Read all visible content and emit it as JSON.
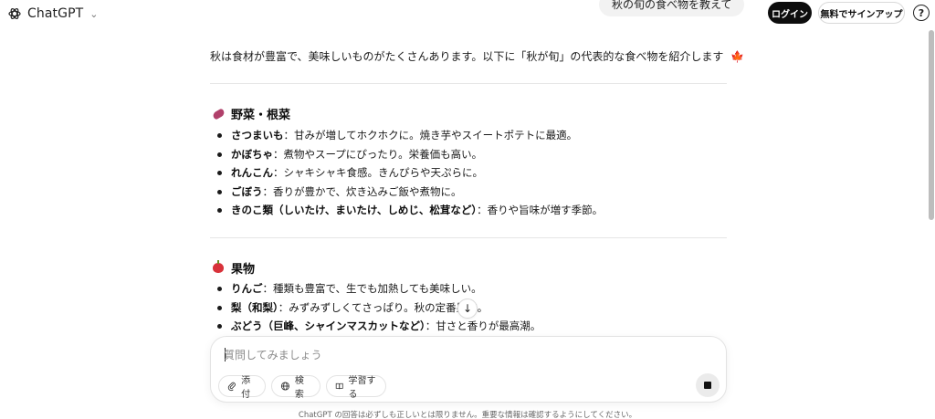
{
  "header": {
    "app_title": "ChatGPT",
    "login_label": "ログイン",
    "signup_label": "無料でサインアップ",
    "help_label": "?"
  },
  "user_message": "秋の旬の食べ物を教えて",
  "assistant": {
    "intro": "秋は食材が豊富で、美味しいものがたくさんあります。以下に「秋が旬」の代表的な食べ物を紹介します",
    "intro_emoji": "🍁",
    "sections": [
      {
        "title": "野菜・根菜",
        "items": [
          {
            "name": "さつまいも",
            "desc": "：甘みが増してホクホクに。焼き芋やスイートポテトに最適。"
          },
          {
            "name": "かぼちゃ",
            "desc": "：煮物やスープにぴったり。栄養価も高い。"
          },
          {
            "name": "れんこん",
            "desc": "：シャキシャキ食感。きんぴらや天ぷらに。"
          },
          {
            "name": "ごぼう",
            "desc": "：香りが豊かで、炊き込みご飯や煮物に。"
          },
          {
            "name": "きのこ類（しいたけ、まいたけ、しめじ、松茸など）",
            "desc": "：香りや旨味が増す季節。"
          }
        ]
      },
      {
        "title": "果物",
        "items": [
          {
            "name": "りんご",
            "desc": "：種類も豊富で、生でも加熱しても美味しい。"
          },
          {
            "name": "梨（和梨）",
            "desc": "：みずみずしくてさっぱり。秋の定番果物。"
          },
          {
            "name": "ぶどう（巨峰、シャインマスカットなど）",
            "desc": "：甘さと香りが最高潮。"
          }
        ]
      }
    ]
  },
  "composer": {
    "placeholder": "質問してみましょう",
    "attach_label": "添付",
    "search_label": "検索",
    "study_label": "学習する"
  },
  "disclaimer": "ChatGPT の回答は必ずしも正しいとは限りません。重要な情報は確認するようにしてください。",
  "colors": {
    "primary_button": "#0d0d0d",
    "bubble_bg": "#f2f2f2",
    "border": "#e3e3e3"
  }
}
